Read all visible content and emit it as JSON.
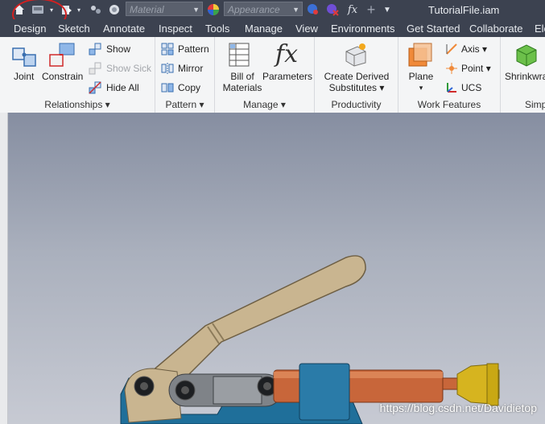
{
  "qat": {
    "material_placeholder": "Material",
    "appearance_placeholder": "Appearance",
    "fx_label": "fx",
    "plus_label": "+",
    "icons": [
      "home-icon",
      "save-icon",
      "undo-icon",
      "select-icon",
      "color-wheel-icon",
      "appearance-color-icon",
      "clear-appearance-icon",
      "parameters-icon",
      "add-icon",
      "customize-arrow-icon"
    ]
  },
  "title": "TutorialFile.iam",
  "tabs": [
    "Design",
    "Sketch",
    "Annotate",
    "Inspect",
    "Tools",
    "Manage",
    "View",
    "Environments",
    "Get Started",
    "Collaborate",
    "Ele"
  ],
  "ribbon": {
    "relationships": {
      "title": "Relationships",
      "joint": "Joint",
      "constrain": "Constrain",
      "show": "Show",
      "show_sick": "Show Sick",
      "hide_all": "Hide All"
    },
    "pattern": {
      "title": "Pattern",
      "pattern": "Pattern",
      "mirror": "Mirror",
      "copy": "Copy"
    },
    "manage": {
      "title": "Manage",
      "bom_line1": "Bill of",
      "bom_line2": "Materials",
      "parameters": "Parameters"
    },
    "productivity": {
      "title": "Productivity",
      "cds_line1": "Create Derived",
      "cds_line2": "Substitutes"
    },
    "work_features": {
      "title": "Work Features",
      "plane": "Plane",
      "axis": "Axis",
      "point": "Point",
      "ucs": "UCS"
    },
    "simplification": {
      "title": "Simpli",
      "shrinkwrap": "Shrinkwra"
    }
  },
  "colors": {
    "qat_bg": "#3c4250",
    "ribbon_bg": "#f4f5f6",
    "highlight": "#d42020"
  },
  "watermark": "https://blog.csdn.net/Davidietop"
}
